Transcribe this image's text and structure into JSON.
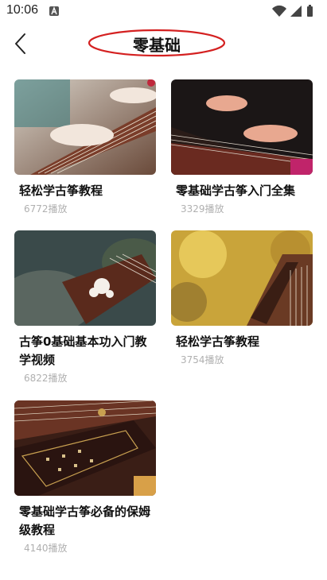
{
  "status": {
    "time": "10:06"
  },
  "header": {
    "title": "零基础"
  },
  "videos": [
    {
      "title": "轻松学古筝教程",
      "plays": "6772播放"
    },
    {
      "title": "零基础学古筝入门全集",
      "plays": "3329播放"
    },
    {
      "title": "古筝0基础基本功入门教学视频",
      "plays": "6822播放"
    },
    {
      "title": "轻松学古筝教程",
      "plays": "3754播放"
    },
    {
      "title": "零基础学古筝必备的保姆级教程",
      "plays": "4140播放"
    }
  ],
  "colors": {
    "title_ellipse": "#d42020",
    "plays_text": "#b0b0b0"
  },
  "icons": {
    "back": "chevron-left-icon",
    "wifi": "wifi-icon",
    "signal": "signal-icon",
    "battery": "battery-icon",
    "notification": "notification-a-icon"
  }
}
